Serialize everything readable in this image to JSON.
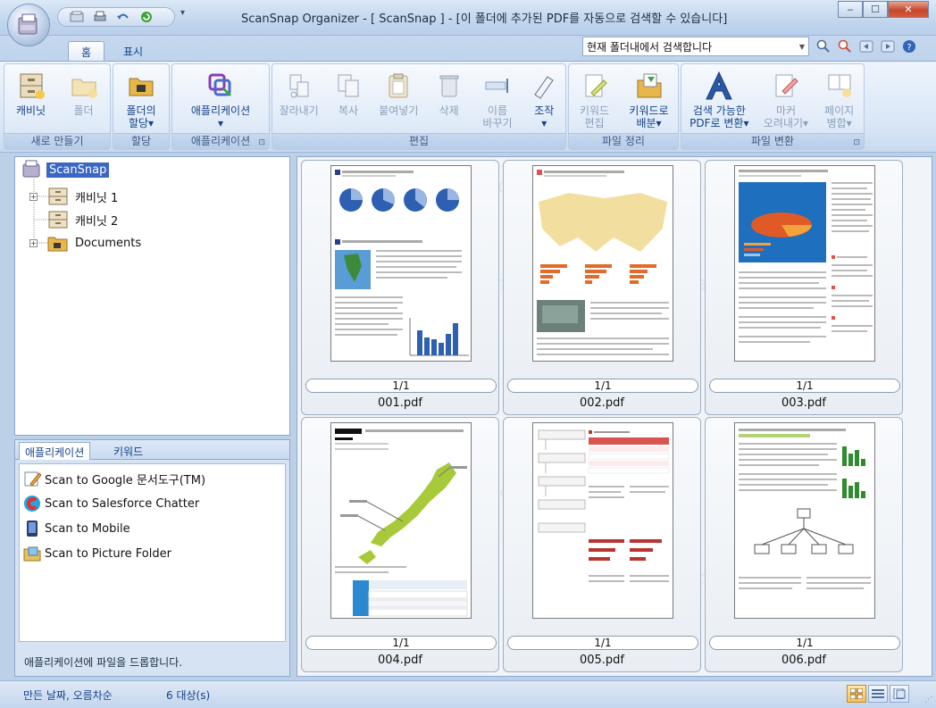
{
  "window": {
    "title": "ScanSnap Organizer - [ ScanSnap ] - [이 폴더에 추가된 PDF를 자동으로 검색할 수 있습니다]",
    "controls": [
      "minimize",
      "maximize",
      "close"
    ]
  },
  "tabs": [
    "홈",
    "표시"
  ],
  "search": {
    "value": "현재 폴더내에서 검색합니다"
  },
  "ribbon": {
    "groups": [
      {
        "label": "새로 만들기",
        "buttons": [
          {
            "label": "캐비닛",
            "icon": "cabinet-icon"
          },
          {
            "label": "폴더",
            "icon": "folder-icon"
          }
        ]
      },
      {
        "label": "할당",
        "buttons": [
          {
            "label": "폴더의\n할당▾",
            "icon": "folder-assign-icon"
          }
        ]
      },
      {
        "label": "애플리케이션",
        "buttons": [
          {
            "label": "애플리케이션\n▾",
            "icon": "application-icon"
          }
        ]
      },
      {
        "label": "편집",
        "buttons": [
          {
            "label": "잘라내기",
            "icon": "cut-icon"
          },
          {
            "label": "복사",
            "icon": "copy-icon"
          },
          {
            "label": "붙여넣기",
            "icon": "paste-icon"
          },
          {
            "label": "삭제",
            "icon": "delete-icon"
          },
          {
            "label": "이름\n바꾸기",
            "icon": "rename-icon"
          },
          {
            "label": "조작\n▾",
            "icon": "operate-icon"
          }
        ]
      },
      {
        "label": "파일 정리",
        "buttons": [
          {
            "label": "키워드\n편집",
            "icon": "keyword-edit-icon"
          },
          {
            "label": "키워드로\n배분▾",
            "icon": "keyword-sort-icon"
          }
        ]
      },
      {
        "label": "파일 변환",
        "buttons": [
          {
            "label": "검색 가능한\nPDF로 변환▾",
            "icon": "searchable-pdf-icon"
          },
          {
            "label": "마커\n오려내기▾",
            "icon": "marker-icon"
          },
          {
            "label": "페이지\n병합▾",
            "icon": "merge-pages-icon"
          }
        ]
      }
    ]
  },
  "tree": {
    "root": "ScanSnap",
    "items": [
      "캐비닛 1",
      "캐비닛 2",
      "Documents"
    ]
  },
  "app_panel": {
    "tabs": [
      "애플리케이션",
      "키워드"
    ],
    "items": [
      "Scan to Google 문서도구(TM)",
      "Scan to Salesforce Chatter",
      "Scan to Mobile",
      "Scan to Picture Folder"
    ],
    "hint": "애플리케이션에 파일을 드롭합니다."
  },
  "files": [
    {
      "name": "001.pdf",
      "pages": "1/1"
    },
    {
      "name": "002.pdf",
      "pages": "1/1"
    },
    {
      "name": "003.pdf",
      "pages": "1/1"
    },
    {
      "name": "004.pdf",
      "pages": "1/1"
    },
    {
      "name": "005.pdf",
      "pages": "1/1"
    },
    {
      "name": "006.pdf",
      "pages": "1/1"
    }
  ],
  "watermark": "ScanSnap",
  "status": {
    "sort": "만든 날짜, 오름차순",
    "count": "6 대상(s)"
  },
  "colors": {
    "ribbon_text": "#15428b",
    "selection": "#3a67c4",
    "accent_orange": "#f7c150"
  }
}
